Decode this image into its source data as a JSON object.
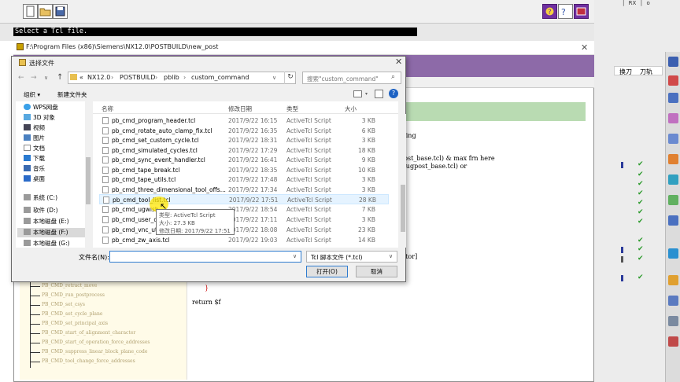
{
  "app": {
    "status_text": "Select a Tcl file.",
    "right_header": "换刀  刀轨",
    "col_head_1": "换刀",
    "col_head_2": "刀轨",
    "menu_tail": "│  RX  │  o"
  },
  "postbuild": {
    "title": "F:\\Program Files (x86)\\Siemens\\NX12.0\\POSTBUILD\\new_post",
    "code_lines": [
      "eing",
      "gpost_base.tcl) & max frn here",
      " in ugpost_base.tcl) or",
      "factor]",
      "}",
      "return $f"
    ],
    "tree_items": [
      "PB_CMD_retract_move",
      "PB_CMD_run_postprocess",
      "PB_CMD_set_csys",
      "PB_CMD_set_cycle_plane",
      "PB_CMD_set_principal_axis",
      "PB_CMD_start_of_alignment_character",
      "PB_CMD_start_of_operation_force_addresses",
      "PB_CMD_suppress_linear_block_plane_code",
      "PB_CMD_tool_change_force_addresses"
    ]
  },
  "dialog": {
    "title": "选择文件",
    "breadcrumb": [
      "«",
      "NX12.0",
      "POSTBUILD",
      "pblib",
      "custom_command"
    ],
    "search_placeholder": "搜索\"custom_command\"",
    "toolbar": {
      "organize": "组织 ▾",
      "new_folder": "新建文件夹"
    },
    "nav": [
      {
        "label": "WPS网盘",
        "icon": "cloud-icon"
      },
      {
        "label": "3D 对象",
        "icon": "cube-icon"
      },
      {
        "label": "视频",
        "icon": "video-icon"
      },
      {
        "label": "图片",
        "icon": "picture-icon"
      },
      {
        "label": "文档",
        "icon": "document-icon"
      },
      {
        "label": "下载",
        "icon": "download-icon"
      },
      {
        "label": "音乐",
        "icon": "music-icon"
      },
      {
        "label": "桌面",
        "icon": "desktop-icon"
      },
      {
        "label": "系统 (C:)",
        "icon": "drive-icon"
      },
      {
        "label": "软件 (D:)",
        "icon": "drive-icon"
      },
      {
        "label": "本地磁盘 (E:)",
        "icon": "drive-icon"
      },
      {
        "label": "本地磁盘 (F:)",
        "icon": "drive-icon"
      },
      {
        "label": "本地磁盘 (G:)",
        "icon": "drive-icon"
      }
    ],
    "columns": {
      "name": "名称",
      "date": "修改日期",
      "type": "类型",
      "size": "大小"
    },
    "files": [
      {
        "name": "pb_cmd_program_header.tcl",
        "date": "2017/9/22 16:15",
        "type": "ActiveTcl Script",
        "size": "3 KB"
      },
      {
        "name": "pb_cmd_rotate_auto_clamp_fix.tcl",
        "date": "2017/9/22 16:35",
        "type": "ActiveTcl Script",
        "size": "6 KB"
      },
      {
        "name": "pb_cmd_set_custom_cycle.tcl",
        "date": "2017/9/22 18:31",
        "type": "ActiveTcl Script",
        "size": "3 KB"
      },
      {
        "name": "pb_cmd_simulated_cycles.tcl",
        "date": "2017/9/22 17:29",
        "type": "ActiveTcl Script",
        "size": "18 KB"
      },
      {
        "name": "pb_cmd_sync_event_handler.tcl",
        "date": "2017/9/22 16:41",
        "type": "ActiveTcl Script",
        "size": "9 KB"
      },
      {
        "name": "pb_cmd_tape_break.tcl",
        "date": "2017/9/22 18:35",
        "type": "ActiveTcl Script",
        "size": "10 KB"
      },
      {
        "name": "pb_cmd_tape_utils.tcl",
        "date": "2017/9/22 17:48",
        "type": "ActiveTcl Script",
        "size": "3 KB"
      },
      {
        "name": "pb_cmd_three_dimensional_tool_offs...",
        "date": "2017/9/22 17:34",
        "type": "ActiveTcl Script",
        "size": "3 KB"
      },
      {
        "name": "pb_cmd_tool_list.tcl",
        "date": "2017/9/22 17:51",
        "type": "ActiveTcl Script",
        "size": "28 KB"
      },
      {
        "name": "pb_cmd_ugwish",
        "date": "2017/9/22 18:54",
        "type": "ActiveTcl Script",
        "size": "7 KB"
      },
      {
        "name": "pb_cmd_user_de",
        "date": "2017/9/22 17:11",
        "type": "ActiveTcl Script",
        "size": "3 KB"
      },
      {
        "name": "pb_cmd_vnc_uti",
        "date": "2017/9/22 18:08",
        "type": "ActiveTcl Script",
        "size": "23 KB"
      },
      {
        "name": "pb_cmd_zw_axis.tcl",
        "date": "2017/9/22 19:03",
        "type": "ActiveTcl Script",
        "size": "14 KB"
      }
    ],
    "tooltip": {
      "type": "类型: ActiveTcl Script",
      "size": "大小: 27.3 KB",
      "date": "修改日期: 2017/9/22 17:51"
    },
    "filename_label": "文件名(N):",
    "filename_value": "",
    "filetype": "Tcl 脚本文件 (*.tcl)",
    "open_label": "打开(O)",
    "cancel_label": "取消"
  },
  "colors": {
    "purple": "#8d6aa8",
    "green": "#b9dbb2",
    "select_blue": "#e5f3ff",
    "check_green": "#2a9a2a"
  }
}
